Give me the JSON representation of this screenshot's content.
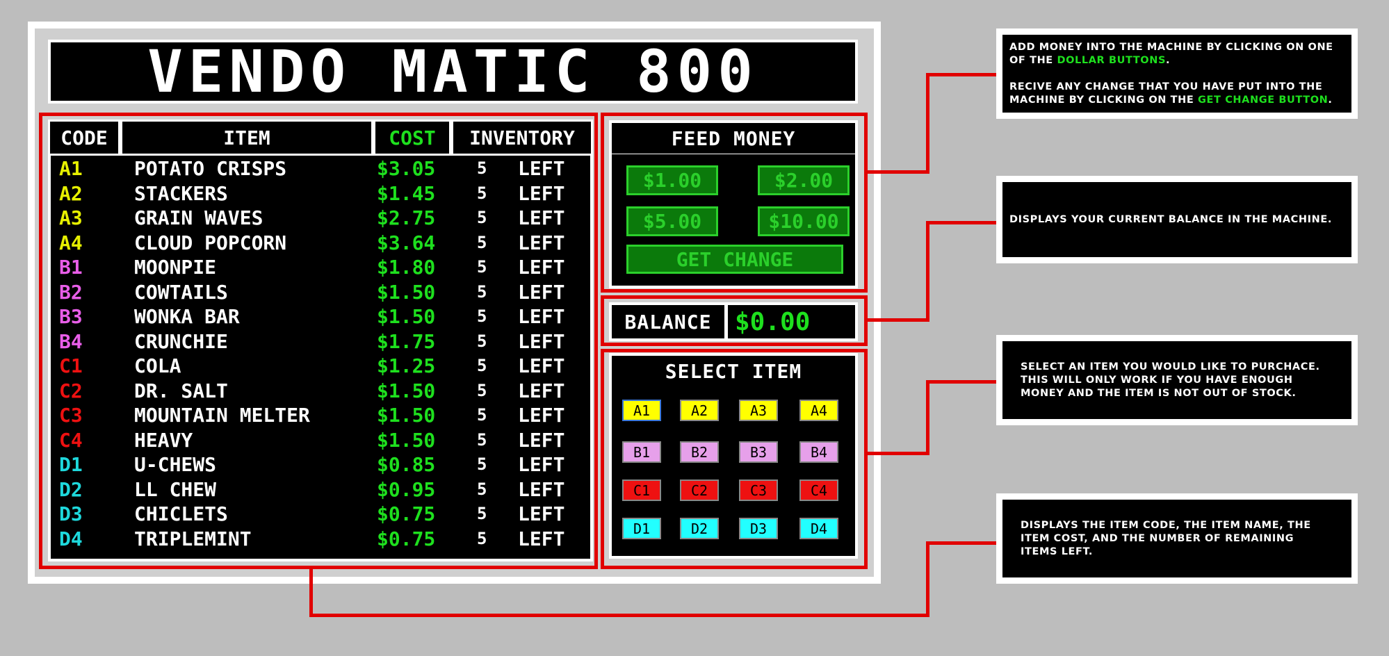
{
  "app_title": "VENDO MATIC 800",
  "table": {
    "headers": {
      "code": "CODE",
      "item": "ITEM",
      "cost": "COST",
      "inventory": "INVENTORY"
    },
    "rows": [
      {
        "code": "A1",
        "name": "POTATO CRISPS",
        "cost": "$3.05",
        "qty": "5",
        "left": "LEFT",
        "color": "#e6f000"
      },
      {
        "code": "A2",
        "name": "STACKERS",
        "cost": "$1.45",
        "qty": "5",
        "left": "LEFT",
        "color": "#e6f000"
      },
      {
        "code": "A3",
        "name": "GRAIN WAVES",
        "cost": "$2.75",
        "qty": "5",
        "left": "LEFT",
        "color": "#e6f000"
      },
      {
        "code": "A4",
        "name": "CLOUD POPCORN",
        "cost": "$3.64",
        "qty": "5",
        "left": "LEFT",
        "color": "#e6f000"
      },
      {
        "code": "B1",
        "name": "MOONPIE",
        "cost": "$1.80",
        "qty": "5",
        "left": "LEFT",
        "color": "#e85ee8"
      },
      {
        "code": "B2",
        "name": "COWTAILS",
        "cost": "$1.50",
        "qty": "5",
        "left": "LEFT",
        "color": "#e85ee8"
      },
      {
        "code": "B3",
        "name": "WONKA BAR",
        "cost": "$1.50",
        "qty": "5",
        "left": "LEFT",
        "color": "#e85ee8"
      },
      {
        "code": "B4",
        "name": "CRUNCHIE",
        "cost": "$1.75",
        "qty": "5",
        "left": "LEFT",
        "color": "#e85ee8"
      },
      {
        "code": "C1",
        "name": "COLA",
        "cost": "$1.25",
        "qty": "5",
        "left": "LEFT",
        "color": "#ee1111"
      },
      {
        "code": "C2",
        "name": "DR. SALT",
        "cost": "$1.50",
        "qty": "5",
        "left": "LEFT",
        "color": "#ee1111"
      },
      {
        "code": "C3",
        "name": "MOUNTAIN MELTER",
        "cost": "$1.50",
        "qty": "5",
        "left": "LEFT",
        "color": "#ee1111"
      },
      {
        "code": "C4",
        "name": "HEAVY",
        "cost": "$1.50",
        "qty": "5",
        "left": "LEFT",
        "color": "#ee1111"
      },
      {
        "code": "D1",
        "name": "U-CHEWS",
        "cost": "$0.85",
        "qty": "5",
        "left": "LEFT",
        "color": "#1ed8dc"
      },
      {
        "code": "D2",
        "name": "LL CHEW",
        "cost": "$0.95",
        "qty": "5",
        "left": "LEFT",
        "color": "#1ed8dc"
      },
      {
        "code": "D3",
        "name": "CHICLETS",
        "cost": "$0.75",
        "qty": "5",
        "left": "LEFT",
        "color": "#1ed8dc"
      },
      {
        "code": "D4",
        "name": "TRIPLEMINT",
        "cost": "$0.75",
        "qty": "5",
        "left": "LEFT",
        "color": "#1ed8dc"
      }
    ]
  },
  "feed_money": {
    "title": "FEED MONEY",
    "btn_1": "$1.00",
    "btn_2": "$2.00",
    "btn_5": "$5.00",
    "btn_10": "$10.00",
    "get_change": "GET CHANGE"
  },
  "balance": {
    "label": "BALANCE",
    "value": "$0.00"
  },
  "select_item": {
    "title": "SELECT ITEM",
    "buttons": [
      {
        "code": "A1",
        "color": "#ffff00"
      },
      {
        "code": "A2",
        "color": "#ffff00"
      },
      {
        "code": "A3",
        "color": "#ffff00"
      },
      {
        "code": "A4",
        "color": "#ffff00"
      },
      {
        "code": "B1",
        "color": "#e6a0ea"
      },
      {
        "code": "B2",
        "color": "#e6a0ea"
      },
      {
        "code": "B3",
        "color": "#e6a0ea"
      },
      {
        "code": "B4",
        "color": "#e6a0ea"
      },
      {
        "code": "C1",
        "color": "#ee1111"
      },
      {
        "code": "C2",
        "color": "#ee1111"
      },
      {
        "code": "C3",
        "color": "#ee1111"
      },
      {
        "code": "C4",
        "color": "#ee1111"
      },
      {
        "code": "D1",
        "color": "#22ffff"
      },
      {
        "code": "D2",
        "color": "#22ffff"
      },
      {
        "code": "D3",
        "color": "#22ffff"
      },
      {
        "code": "D4",
        "color": "#22ffff"
      }
    ]
  },
  "callouts": {
    "money_p1_a": "ADD MONEY INTO THE MACHINE BY CLICKING ON ONE OF THE ",
    "money_p1_hl": "DOLLAR BUTTONS",
    "money_p1_b": ".",
    "money_p2_a": "RECIVE ANY CHANGE THAT YOU HAVE PUT INTO THE MACHINE BY CLICKING ON THE ",
    "money_p2_hl": "GET CHANGE BUTTON",
    "money_p2_b": ".",
    "balance": "DISPLAYS YOUR CURRENT BALANCE IN THE MACHINE.",
    "select": "SELECT AN ITEM YOU WOULD LIKE TO PURCHACE. THIS WILL ONLY WORK IF YOU HAVE ENOUGH MONEY AND THE ITEM IS NOT OUT OF STOCK.",
    "table": "DISPLAYS THE ITEM CODE, THE ITEM NAME, THE ITEM COST, AND THE NUMBER OF REMAINING ITEMS LEFT."
  },
  "colors": {
    "accent_red": "#e10000",
    "money_green": "#1ee01e",
    "background": "#bdbdbd"
  }
}
